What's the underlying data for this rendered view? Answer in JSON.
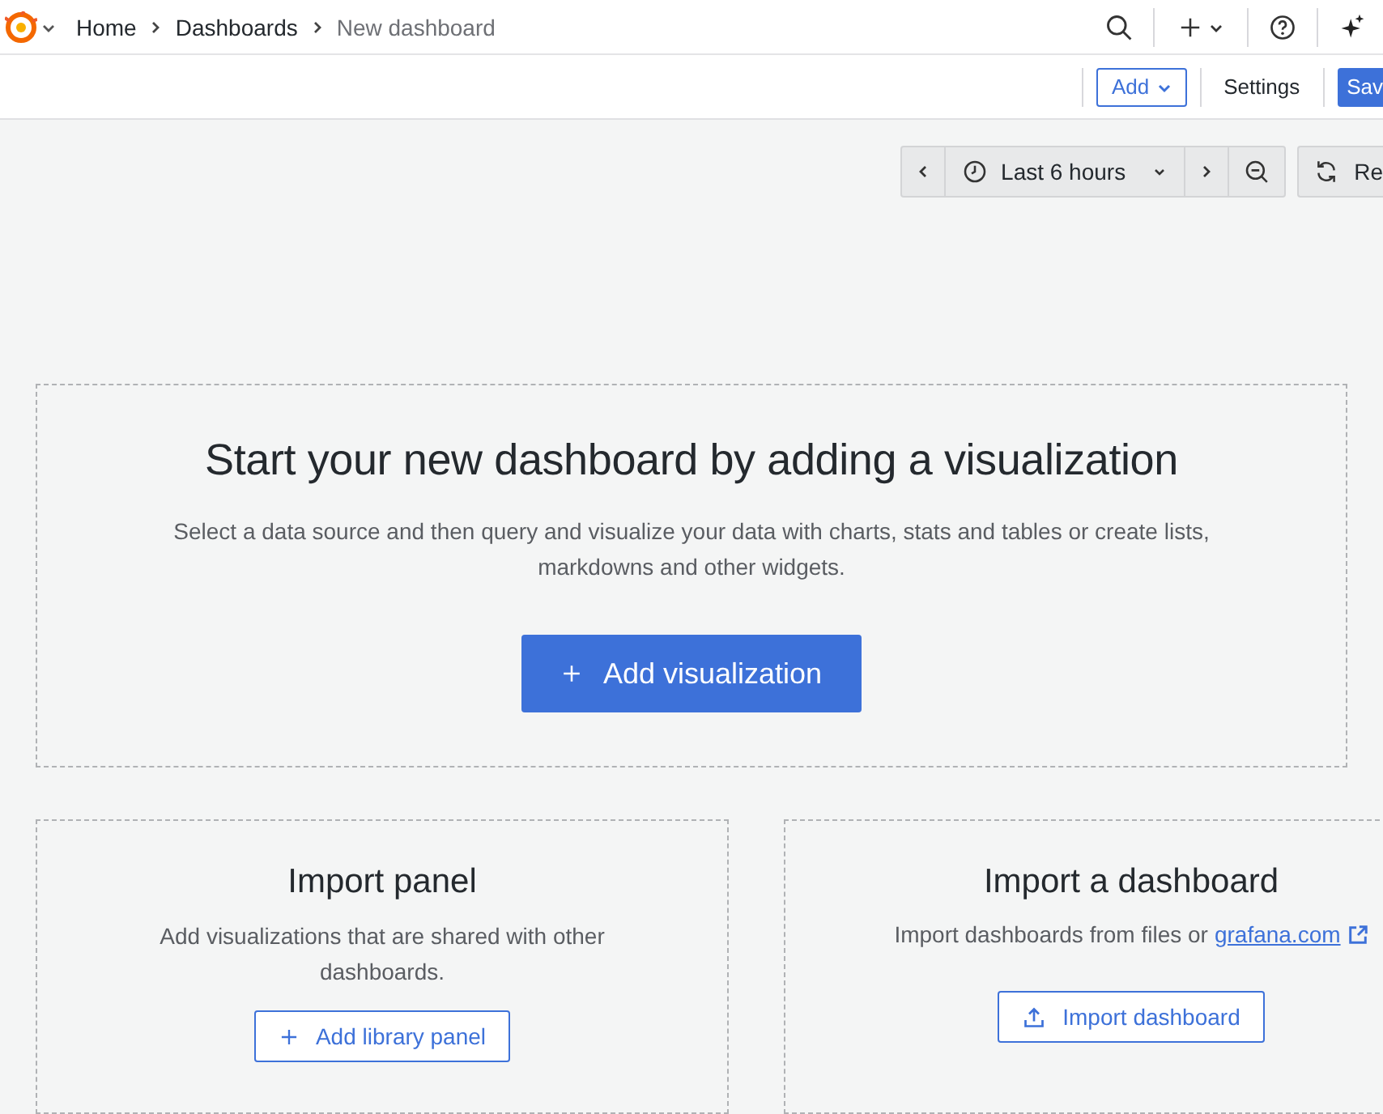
{
  "topbar": {
    "breadcrumbs": [
      {
        "label": "Home",
        "current": false
      },
      {
        "label": "Dashboards",
        "current": false
      },
      {
        "label": "New dashboard",
        "current": true
      }
    ]
  },
  "toolbar": {
    "add_button": "Add",
    "settings_button": "Settings",
    "save_button": "Sav"
  },
  "time_controls": {
    "range": "Last 6 hours",
    "refresh_button": "Re"
  },
  "empty_state": {
    "title": "Start your new dashboard by adding a visualization",
    "description": "Select a data source and then query and visualize your data with charts, stats and tables or create lists, markdowns and other widgets.",
    "button": "Add visualization"
  },
  "import_panel": {
    "title": "Import panel",
    "description": "Add visualizations that are shared with other dashboards.",
    "button": "Add library panel"
  },
  "import_dashboard": {
    "title": "Import a dashboard",
    "description": "Import dashboards from files or",
    "link": "grafana.com",
    "button": "Import dashboard"
  }
}
